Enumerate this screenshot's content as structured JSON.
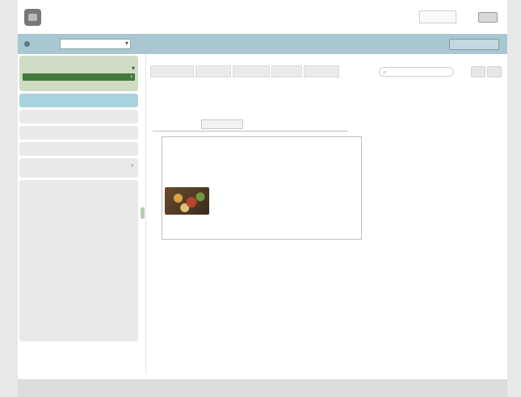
{
  "header": {
    "brand": "",
    "col1": [
      "",
      ""
    ],
    "col2": [
      "",
      ""
    ],
    "col3": [
      "",
      ""
    ],
    "button": ""
  },
  "toolbar": {
    "select": "",
    "right_button": ""
  },
  "sidebar": {
    "group": {
      "head": "",
      "sub": "",
      "active": "",
      "third": ""
    },
    "items": [
      "",
      "",
      "",
      "",
      ""
    ],
    "last": {
      "label": "",
      "sub": ""
    }
  },
  "main": {
    "tabs": [
      "",
      "",
      "",
      "",
      ""
    ],
    "search": "",
    "nav": [
      "",
      ""
    ],
    "view_title": "",
    "view_links": "",
    "pager": "",
    "filter_label": "",
    "filter_value": "",
    "card": {
      "title": "",
      "subtitle": "",
      "facts": [
        "",
        "",
        "",
        "",
        "",
        "",
        "",
        "",
        ""
      ],
      "footer": ""
    }
  },
  "footer": {
    "left": "",
    "right": ""
  }
}
